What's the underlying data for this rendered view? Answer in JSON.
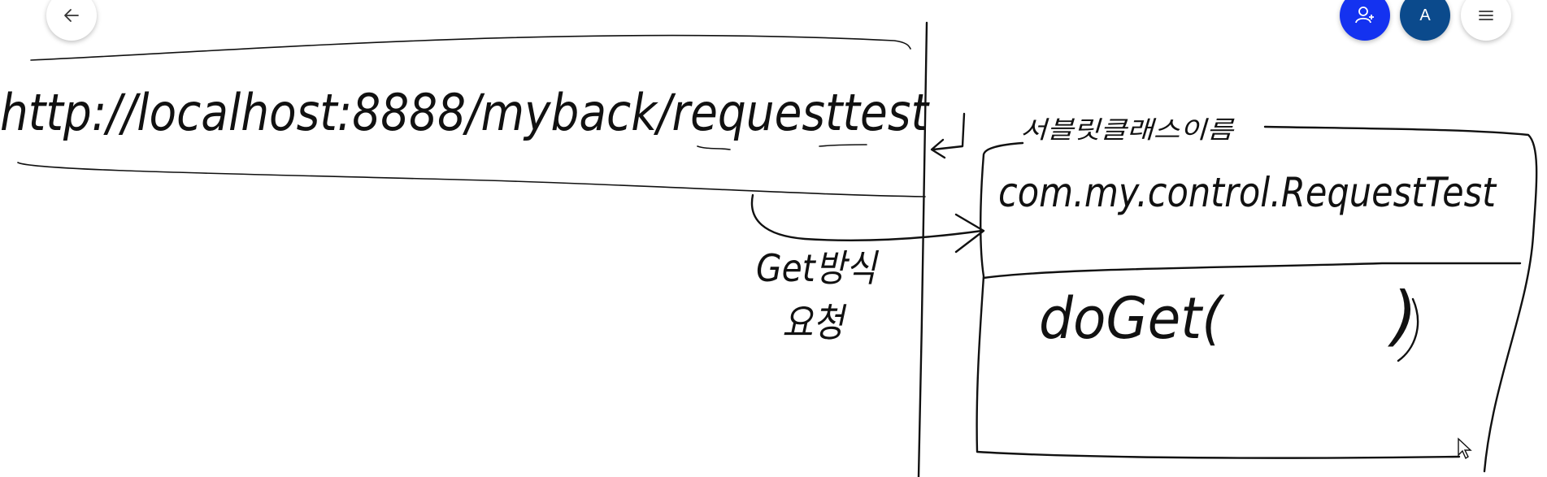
{
  "toolbar": {
    "back_icon": "arrow-left-icon",
    "share_icon": "add-person-icon",
    "account_initial": "A",
    "menu_icon": "hamburger-menu-icon",
    "colors": {
      "share": "#1432f0",
      "account": "#0b4a8c"
    }
  },
  "whiteboard": {
    "url_text": "http://localhost:8888/myback/requesttest",
    "servlet_class_label": "서블릿클래스이름",
    "class_name": "com.my.control.RequestTest",
    "method_text": "doGet(",
    "method_close": ")",
    "request_label_line1": "Get방식",
    "request_label_line2": "요청"
  }
}
